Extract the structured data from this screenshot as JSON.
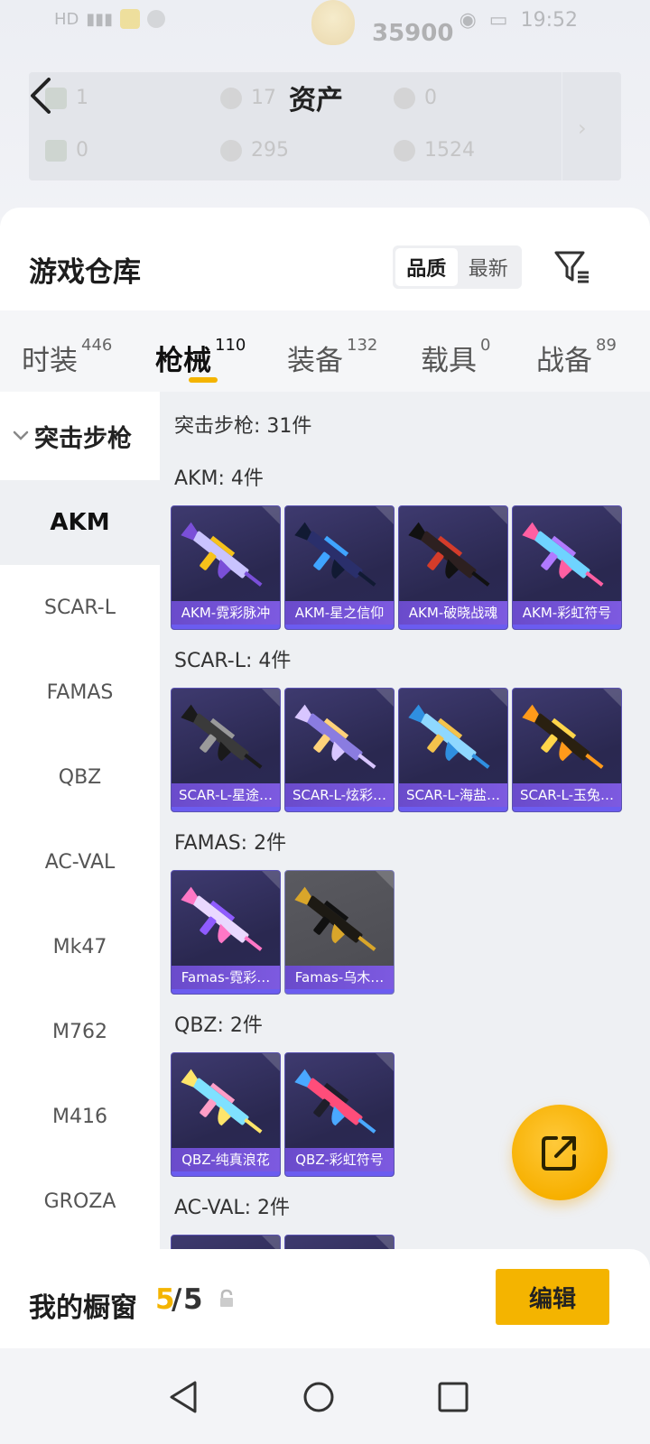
{
  "status_bar": {
    "time": "19:52",
    "coins": "35900"
  },
  "assets": {
    "title": "资产",
    "values": [
      "1",
      "17",
      "0",
      "0",
      "295",
      "1524"
    ]
  },
  "warehouse": {
    "title": "游戏仓库",
    "sort_options": [
      "品质",
      "最新"
    ],
    "sort_selected": "品质"
  },
  "categories": [
    {
      "label": "时装",
      "count": "446"
    },
    {
      "label": "枪械",
      "count": "110",
      "active": true
    },
    {
      "label": "装备",
      "count": "132"
    },
    {
      "label": "载具",
      "count": "0"
    },
    {
      "label": "战备",
      "count": "89"
    }
  ],
  "sidebar": {
    "header": "突击步枪",
    "items": [
      "AKM",
      "SCAR-L",
      "FAMAS",
      "QBZ",
      "AC-VAL",
      "Mk47",
      "M762",
      "M416",
      "GROZA"
    ],
    "active": "AKM"
  },
  "grid": {
    "summary": "突击步枪: 31件",
    "sections": [
      {
        "title": "AKM: 4件",
        "items": [
          {
            "name": "AKM-霓彩脉冲",
            "colors": [
              "#c9c3ff",
              "#7a4fd8",
              "#f6c21a"
            ]
          },
          {
            "name": "AKM-星之信仰",
            "colors": [
              "#2a2f6b",
              "#111a33",
              "#3fa4ff"
            ]
          },
          {
            "name": "AKM-破晓战魂",
            "colors": [
              "#2d2020",
              "#111111",
              "#d43c2a"
            ]
          },
          {
            "name": "AKM-彩虹符号",
            "colors": [
              "#6fd3ff",
              "#ff5fa2",
              "#b07aff"
            ]
          }
        ]
      },
      {
        "title": "SCAR-L: 4件",
        "items": [
          {
            "name": "SCAR-L-星途…",
            "colors": [
              "#3a3a3a",
              "#1a1a1a",
              "#9a9a9a"
            ]
          },
          {
            "name": "SCAR-L-炫彩…",
            "colors": [
              "#8a7ce0",
              "#d8c6ff",
              "#ffd27a"
            ]
          },
          {
            "name": "SCAR-L-海盐…",
            "colors": [
              "#8fd8ff",
              "#2f8fe0",
              "#f4c34c"
            ]
          },
          {
            "name": "SCAR-L-玉兔…",
            "colors": [
              "#2a2010",
              "#ff9a1a",
              "#ffd54a"
            ]
          }
        ]
      },
      {
        "title": "FAMAS: 2件",
        "items": [
          {
            "name": "Famas-霓彩…",
            "colors": [
              "#e9d8ff",
              "#ff77c6",
              "#8f5bff"
            ]
          },
          {
            "name": "Famas-乌木…",
            "colors": [
              "#1d1a14",
              "#d9a62a",
              "#111111"
            ],
            "gray": true
          }
        ]
      },
      {
        "title": "QBZ: 2件",
        "items": [
          {
            "name": "QBZ-纯真浪花",
            "colors": [
              "#7fe1ff",
              "#ffe56a",
              "#ff9ec7"
            ]
          },
          {
            "name": "QBZ-彩虹符号",
            "colors": [
              "#ff4d7a",
              "#4aa8ff",
              "#1e1e2a"
            ]
          }
        ]
      },
      {
        "title": "AC-VAL: 2件",
        "items": [
          {
            "name": "",
            "colors": [
              "#2a2850",
              "#2a2850",
              "#2a2850"
            ]
          },
          {
            "name": "",
            "colors": [
              "#2a2850",
              "#2a2850",
              "#2a2850"
            ]
          }
        ]
      }
    ]
  },
  "showcase": {
    "label": "我的橱窗",
    "count": "5",
    "separator": "/",
    "total": "5",
    "edit_label": "编辑"
  },
  "accent_color": "#f4b400",
  "icons": {
    "back": "chevron-left-icon",
    "filter": "filter-icon",
    "fab": "share-external-icon",
    "lock": "lock-icon"
  }
}
